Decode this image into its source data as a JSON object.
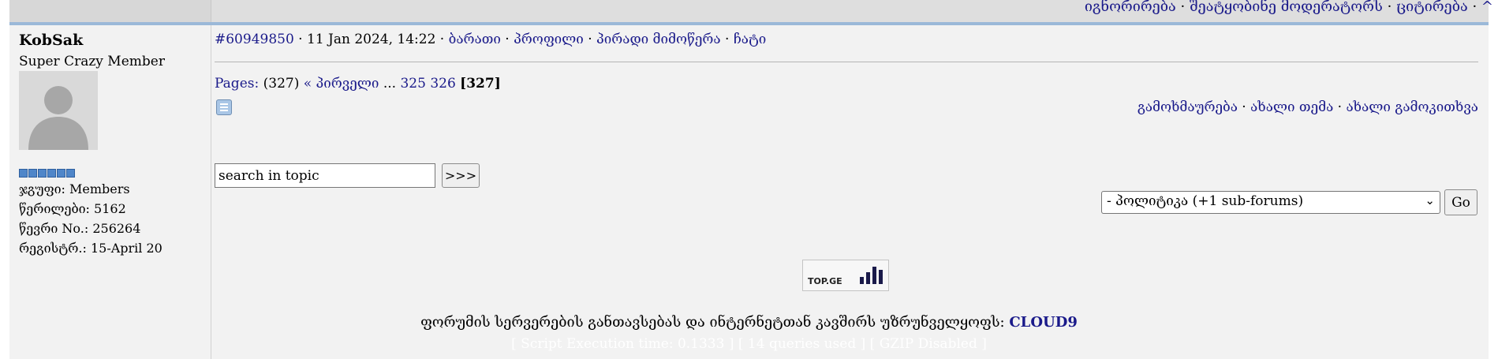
{
  "header": {
    "links": [
      "იგნორირება",
      "შეატყობინე მოდერატორს ",
      "ციტირება",
      "^"
    ],
    "sep": " · "
  },
  "user": {
    "name": "KobSak",
    "title": "Super Crazy Member",
    "star_count": 6,
    "group": "ჯგუფი: Members",
    "posts": "წერილები: 5162",
    "member_no": "წევრი No.: 256264",
    "registered": "რეგისტრ.: 15-April 20"
  },
  "post": {
    "id": "#60949850",
    "datetime": "11 Jan 2024, 14:22",
    "links": [
      "ბარათი",
      "პროფილი",
      "პირადი მიმოწერა",
      "ჩატი"
    ]
  },
  "pages": {
    "label": "Pages:",
    "count": "(327)",
    "first": "« პირველი",
    "ellipsis": "...",
    "p1": "325",
    "p2": "326",
    "current": "[327]"
  },
  "actions": [
    "გამოხმაურება",
    "ახალი თემა",
    "ახალი გამოკითხვა"
  ],
  "search": {
    "value": "search in topic",
    "go_label": ">>>"
  },
  "forum_select": {
    "selected": "- პოლიტიკა (+1 sub-forums)",
    "go_label": "Go"
  },
  "badge": {
    "text": "TOP.GE"
  },
  "credit": {
    "text": "ფორუმის სერვერების განთავსებას და ინტერნეტთან კავშირს უზრუნველყოფს:",
    "link": "CLOUD9"
  },
  "stats": {
    "text": "[ Script Execution time: 0.1333 ]   [ 14 queries used ]   [ GZIP Disabled ]"
  }
}
